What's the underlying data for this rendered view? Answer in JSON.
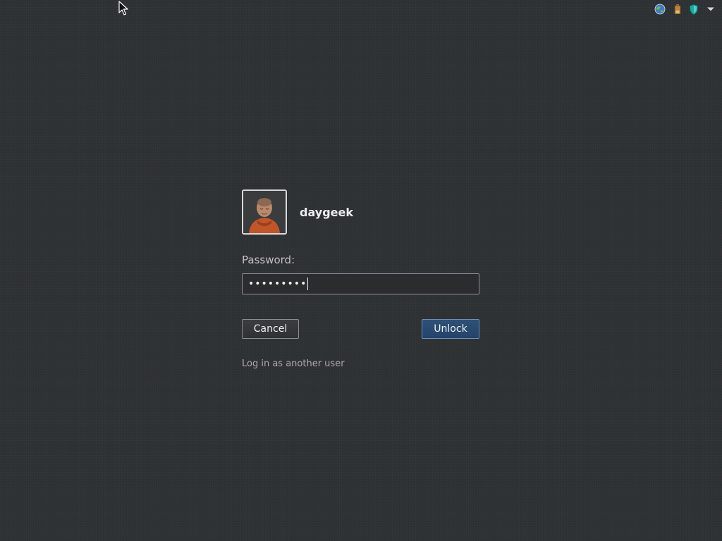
{
  "tray": {
    "icons": [
      "globe-icon",
      "battery-icon",
      "shield-icon",
      "chevron-down-icon"
    ]
  },
  "user": {
    "name": "daygeek",
    "avatar": "user-avatar"
  },
  "password": {
    "label": "Password:",
    "masked_value": "•••••••••"
  },
  "buttons": {
    "cancel_label": "Cancel",
    "unlock_label": "Unlock"
  },
  "other_user_link": "Log in as another user",
  "colors": {
    "background": "#2e3134",
    "accent": "#2a4a70",
    "text": "#eeeeec"
  }
}
